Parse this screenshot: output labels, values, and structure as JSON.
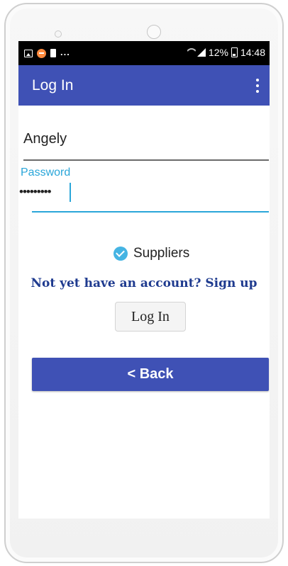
{
  "status_bar": {
    "left_icons": [
      "image-icon",
      "notification-icon",
      "sim-card-icon"
    ],
    "overflow": "...",
    "battery": "12%",
    "time": "14:48"
  },
  "appbar": {
    "title": "Log In",
    "menu_icon": "more-vert-icon"
  },
  "form": {
    "username_value": "Angely",
    "password_label": "Password",
    "password_value": "•••••••••",
    "suppliers_label": "Suppliers",
    "suppliers_checked": true,
    "signup_text": "Not yet have an account? Sign up",
    "login_label": "Log In",
    "back_label": "< Back"
  },
  "colors": {
    "primary": "#3f51b5",
    "accent": "#2aa6d9",
    "link": "#1f3b8f",
    "status_bar": "#000000"
  }
}
